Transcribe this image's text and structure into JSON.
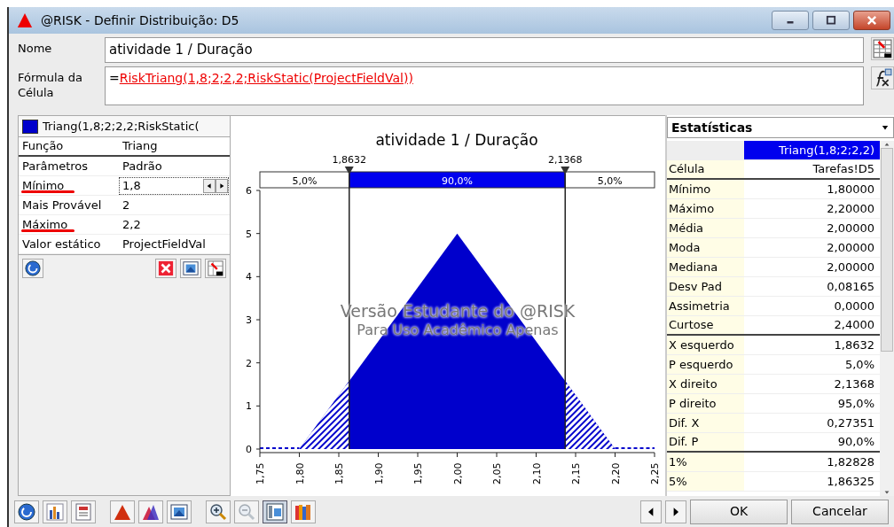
{
  "window": {
    "title": "@RISK - Definir Distribuição: D5"
  },
  "name_field": {
    "label": "Nome",
    "value": "atividade 1 / Duração"
  },
  "formula_field": {
    "label": "Fórmula da Célula",
    "value": "=RiskTriang(1,8;2;2,2;RiskStatic(ProjectFieldVal))"
  },
  "left_panel": {
    "header": "Triang(1,8;2;2,2;RiskStatic(",
    "rows": [
      {
        "label": "Função",
        "value": "Triang",
        "kind": "header",
        "marked": false
      },
      {
        "label": "Parâmetros",
        "value": "Padrão",
        "kind": "text",
        "marked": false
      },
      {
        "label": "Mínimo",
        "value": "1,8",
        "kind": "spinner",
        "marked": true
      },
      {
        "label": "Mais Provável",
        "value": "2",
        "kind": "text",
        "marked": false
      },
      {
        "label": "Máximo",
        "value": "2,2",
        "kind": "text",
        "marked": true
      },
      {
        "label": "Valor estático",
        "value": "ProjectFieldVal",
        "kind": "text",
        "marked": false
      }
    ]
  },
  "chart": {
    "bands": [
      "5,0%",
      "90,0%",
      "5,0%"
    ],
    "watermark": [
      "Versão Estudante do @RISK",
      "Para Uso Acadêmico Apenas"
    ],
    "chart_data": {
      "type": "area",
      "title": "atividade 1 / Duração",
      "x": [
        1.8,
        2.0,
        2.2
      ],
      "series": [
        {
          "color": "#0000cc",
          "values": [
            0,
            5,
            0
          ]
        }
      ],
      "ref_lines": [
        {
          "axis": "x",
          "value": 1.8632,
          "label": "1,8632"
        },
        {
          "axis": "x",
          "value": 2.1368,
          "label": "2,1368"
        }
      ],
      "xlim": [
        1.75,
        2.25
      ],
      "ylim": [
        0,
        6
      ],
      "xticks": [
        {
          "value": 1.75,
          "label": "1,75"
        },
        {
          "value": 1.8,
          "label": "1,80"
        },
        {
          "value": 1.85,
          "label": "1,85"
        },
        {
          "value": 1.9,
          "label": "1,90"
        },
        {
          "value": 1.95,
          "label": "1,95"
        },
        {
          "value": 2.0,
          "label": "2,00"
        },
        {
          "value": 2.05,
          "label": "2,05"
        },
        {
          "value": 2.1,
          "label": "2,10"
        },
        {
          "value": 2.15,
          "label": "2,15"
        },
        {
          "value": 2.2,
          "label": "2,20"
        },
        {
          "value": 2.25,
          "label": "2,25"
        }
      ],
      "yticks": [
        0,
        1,
        2,
        3,
        4,
        5,
        6
      ]
    }
  },
  "statistics": {
    "title": "Estatísticas",
    "column": "Triang(1,8;2;2,2)",
    "rows": [
      {
        "label": "Célula",
        "value": "Tarefas!D5",
        "group_end": true
      },
      {
        "label": "Mínimo",
        "value": "1,80000",
        "group_end": false
      },
      {
        "label": "Máximo",
        "value": "2,20000",
        "group_end": false
      },
      {
        "label": "Média",
        "value": "2,00000",
        "group_end": false
      },
      {
        "label": "Moda",
        "value": "2,00000",
        "group_end": false
      },
      {
        "label": "Mediana",
        "value": "2,00000",
        "group_end": false
      },
      {
        "label": "Desv Pad",
        "value": "0,08165",
        "group_end": false
      },
      {
        "label": "Assimetria",
        "value": "0,0000",
        "group_end": false
      },
      {
        "label": "Curtose",
        "value": "2,4000",
        "group_end": true
      },
      {
        "label": "X esquerdo",
        "value": "1,8632",
        "group_end": false
      },
      {
        "label": "P esquerdo",
        "value": "5,0%",
        "group_end": false
      },
      {
        "label": "X direito",
        "value": "2,1368",
        "group_end": false
      },
      {
        "label": "P direito",
        "value": "95,0%",
        "group_end": false
      },
      {
        "label": "Dif. X",
        "value": "0,27351",
        "group_end": false
      },
      {
        "label": "Dif. P",
        "value": "90,0%",
        "group_end": true
      },
      {
        "label": "1%",
        "value": "1,82828",
        "group_end": false
      },
      {
        "label": "5%",
        "value": "1,86325",
        "group_end": false
      }
    ]
  },
  "toolbar": [
    {
      "kind": "help",
      "disabled": false,
      "selected": false
    },
    {
      "kind": "bars",
      "disabled": false,
      "selected": false
    },
    {
      "kind": "report",
      "disabled": false,
      "selected": false
    },
    {
      "kind": "triangle",
      "disabled": false,
      "selected": false
    },
    {
      "kind": "triangles",
      "disabled": false,
      "selected": false
    },
    {
      "kind": "picture",
      "disabled": false,
      "selected": false
    },
    {
      "kind": "zoom-in",
      "disabled": false,
      "selected": false
    },
    {
      "kind": "zoom-out",
      "disabled": true,
      "selected": false
    },
    {
      "kind": "layout",
      "disabled": false,
      "selected": true
    },
    {
      "kind": "books",
      "disabled": false,
      "selected": false
    }
  ],
  "buttons": [
    "OK",
    "Cancelar"
  ]
}
